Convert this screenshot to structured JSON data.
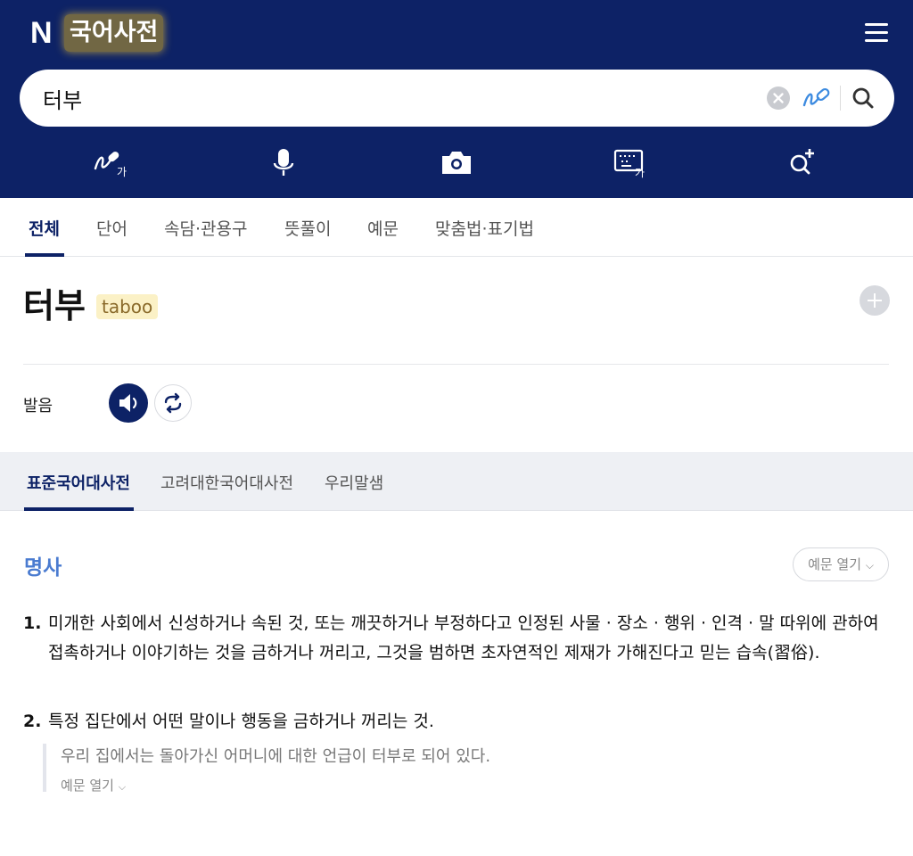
{
  "header": {
    "logo": "N",
    "service_title": "국어사전",
    "search": {
      "value": "터부",
      "placeholder": ""
    }
  },
  "colors": {
    "brand_navy": "#0d2266",
    "accent_blue": "#4a7bd0",
    "highlight_yellow": "#fbf1c6"
  },
  "icons": {
    "tools": [
      "handwriting-icon",
      "microphone-icon",
      "camera-icon",
      "keyboard-icon",
      "zoom-plus-icon"
    ]
  },
  "category_tabs": [
    "전체",
    "단어",
    "속담·관용구",
    "뜻풀이",
    "예문",
    "맞춤법·표기법"
  ],
  "category_active": "전체",
  "entry": {
    "headword": "터부",
    "origin": "taboo",
    "pronunciation_label": "발음"
  },
  "dictionary_tabs": [
    "표준국어대사전",
    "고려대한국어대사전",
    "우리말샘"
  ],
  "dictionary_active": "표준국어대사전",
  "senses_block": {
    "pos": "명사",
    "example_toggle": "예문 열기",
    "senses": [
      {
        "num": "1.",
        "text": "미개한 사회에서 신성하거나 속된 것, 또는 깨끗하거나 부정하다고 인정된 사물 · 장소 · 행위 · 인격 · 말 따위에 관하여 접촉하거나 이야기하는 것을 금하거나 꺼리고, 그것을 범하면 초자연적인 제재가 가해진다고 믿는 습속(習俗)."
      },
      {
        "num": "2.",
        "text": "특정 집단에서 어떤 말이나 행동을 금하거나 꺼리는 것.",
        "example": "우리 집에서는 돌아가신 어머니에 대한 언급이 터부로 되어 있다.",
        "example_more": "예문 열기"
      }
    ]
  }
}
